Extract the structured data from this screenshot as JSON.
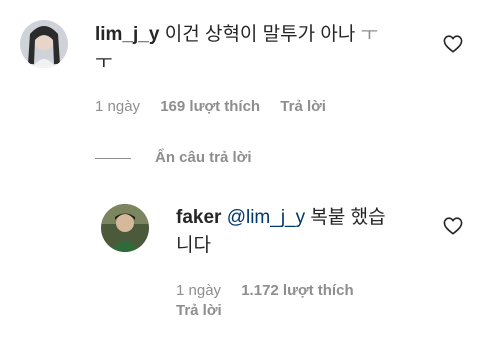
{
  "comment": {
    "username": "lim_j_y",
    "text_line1": "이건 상혁이 말투가 아나",
    "text_tail": "ㅜ",
    "text_line2": "ㅜ",
    "time": "1 ngày",
    "likes": "169 lượt thích",
    "reply_label": "Trả lời",
    "avatar_icon": "user-avatar-photo"
  },
  "hide_replies": {
    "label": "Ẩn câu trả lời"
  },
  "reply": {
    "username": "faker",
    "mention": "@lim_j_y",
    "text_line1": "복붙 했습",
    "text_line2": "니다",
    "time": "1 ngày",
    "likes": "1.172 lượt thích",
    "reply_label": "Trả lời",
    "avatar_icon": "user-avatar-photo"
  },
  "icons": {
    "like": "heart-outline-icon"
  }
}
